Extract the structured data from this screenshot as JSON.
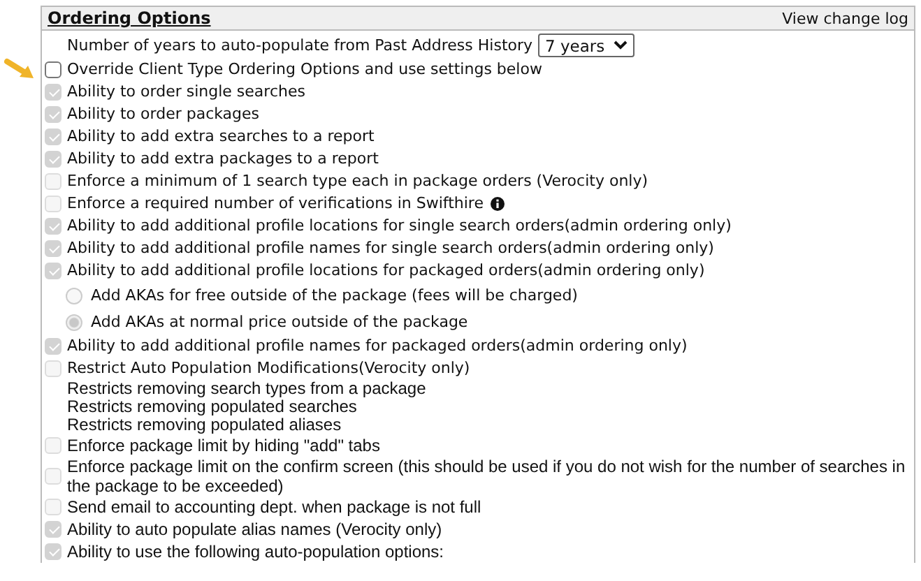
{
  "panel": {
    "title": "Ordering Options",
    "link": "View change log"
  },
  "options": [
    {
      "kind": "select",
      "label": "Number of years to auto-populate from Past Address History",
      "value": "7 years"
    },
    {
      "kind": "checkbox",
      "label": "Override Client Type Ordering Options and use settings below",
      "checked": false,
      "disabled": false,
      "pointer": true
    },
    {
      "kind": "checkbox",
      "label": "Ability to order single searches",
      "checked": true,
      "disabled": true
    },
    {
      "kind": "checkbox",
      "label": "Ability to order packages",
      "checked": true,
      "disabled": true
    },
    {
      "kind": "checkbox",
      "label": "Ability to add extra searches to a report",
      "checked": true,
      "disabled": true
    },
    {
      "kind": "checkbox",
      "label": "Ability to add extra packages to a report",
      "checked": true,
      "disabled": true
    },
    {
      "kind": "checkbox",
      "label": "Enforce a minimum of 1 search type each in package orders (Verocity only)",
      "checked": false,
      "disabled": true
    },
    {
      "kind": "checkbox",
      "label": "Enforce a required number of verifications in Swifthire",
      "checked": false,
      "disabled": true,
      "info": true
    },
    {
      "kind": "checkbox",
      "label": "Ability to add additional profile locations for single search orders(admin ordering only)",
      "checked": true,
      "disabled": true
    },
    {
      "kind": "checkbox",
      "label": "Ability to add additional profile names for single search orders(admin ordering only)",
      "checked": true,
      "disabled": true
    },
    {
      "kind": "checkbox",
      "label": "Ability to add additional profile locations for packaged orders(admin ordering only)",
      "checked": true,
      "disabled": true
    },
    {
      "kind": "radio",
      "label": "Add AKAs for free outside of the package (fees will be charged)",
      "selected": false,
      "disabled": true
    },
    {
      "kind": "radio",
      "label": "Add AKAs at normal price outside of the package",
      "selected": true,
      "disabled": true
    },
    {
      "kind": "checkbox",
      "label": "Ability to add additional profile names for packaged orders(admin ordering only)",
      "checked": true,
      "disabled": true
    },
    {
      "kind": "checkbox",
      "label": "Restrict Auto Population Modifications(Verocity only)",
      "checked": false,
      "disabled": true
    },
    {
      "kind": "note",
      "label": "Restricts removing search types from a package"
    },
    {
      "kind": "note",
      "label": "Restricts removing populated searches"
    },
    {
      "kind": "note",
      "label": "Restricts removing populated aliases"
    },
    {
      "kind": "checkbox",
      "label": "Enforce package limit by hiding \"add\" tabs",
      "checked": false,
      "disabled": true
    },
    {
      "kind": "checkbox",
      "label": "Enforce package limit on the confirm screen (this should be used if you do not wish for the number of searches in the package to be exceeded)",
      "checked": false,
      "disabled": true
    },
    {
      "kind": "checkbox",
      "label": "Send email to accounting dept. when package is not full",
      "checked": false,
      "disabled": true
    },
    {
      "kind": "checkbox",
      "label": "Ability to auto populate alias names (Verocity only)",
      "checked": true,
      "disabled": true
    },
    {
      "kind": "checkbox",
      "label": "Ability to use the following auto-population options:",
      "checked": true,
      "disabled": true
    }
  ]
}
